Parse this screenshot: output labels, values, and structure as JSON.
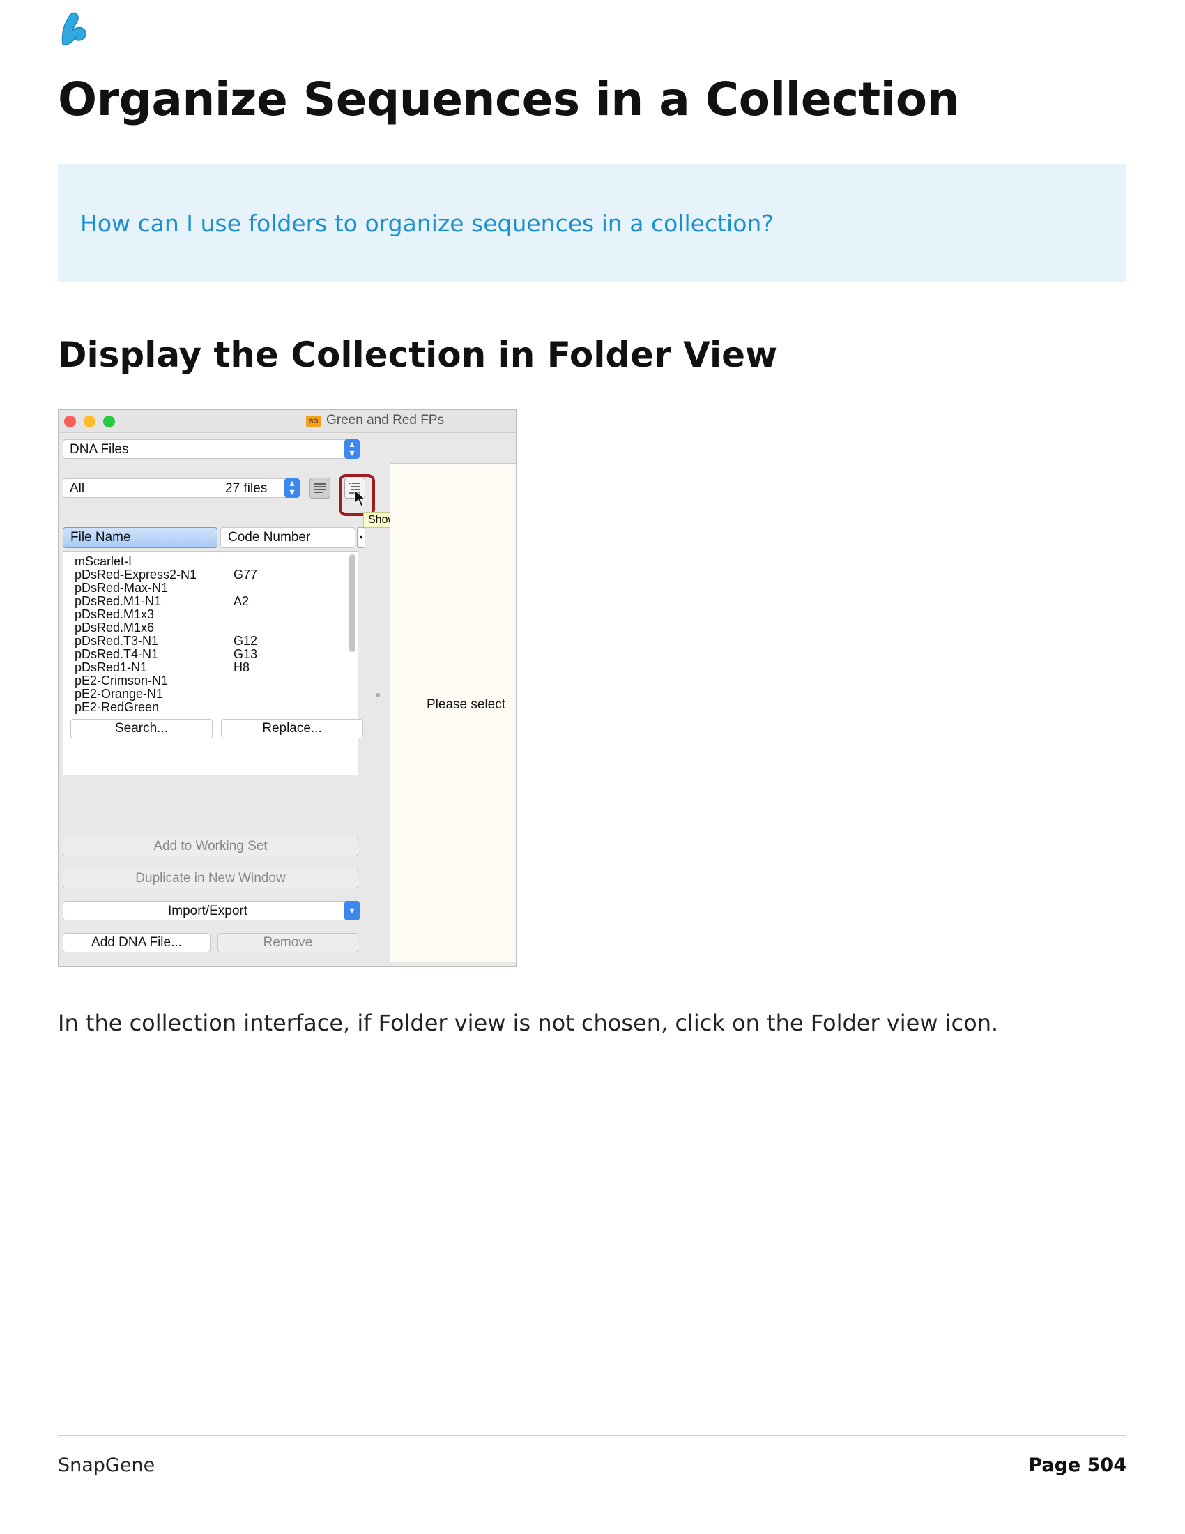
{
  "header": {
    "title": "Organize Sequences in a Collection",
    "question": "How can I use folders to organize sequences in a collection?"
  },
  "section": {
    "heading": "Display the Collection in Folder View",
    "paragraph": "In the collection interface, if Folder view is not chosen, click on the Folder view icon."
  },
  "screenshot": {
    "window_title": "Green and Red FPs",
    "badge": "SG",
    "file_type": "DNA Files",
    "filter": "All",
    "file_count": "27 files",
    "tooltip": "Show folder view",
    "columns": [
      "File Name",
      "Code Number"
    ],
    "rows": [
      {
        "name": "mScarlet-I",
        "code": ""
      },
      {
        "name": "pDsRed-Express2-N1",
        "code": "G77"
      },
      {
        "name": "pDsRed-Max-N1",
        "code": ""
      },
      {
        "name": "pDsRed.M1-N1",
        "code": "A2"
      },
      {
        "name": "pDsRed.M1x3",
        "code": ""
      },
      {
        "name": "pDsRed.M1x6",
        "code": ""
      },
      {
        "name": "pDsRed.T3-N1",
        "code": "G12"
      },
      {
        "name": "pDsRed.T4-N1",
        "code": "G13"
      },
      {
        "name": "pDsRed1-N1",
        "code": "H8"
      },
      {
        "name": "pE2-Crimson-N1",
        "code": ""
      },
      {
        "name": "pE2-Orange-N1",
        "code": ""
      },
      {
        "name": "pE2-RedGreen",
        "code": ""
      }
    ],
    "search_label": "Search...",
    "replace_label": "Replace...",
    "add_working_set": "Add to Working Set",
    "duplicate_window": "Duplicate in New Window",
    "import_export": "Import/Export",
    "add_file": "Add DNA File...",
    "remove": "Remove",
    "placeholder": "Please select"
  },
  "footer": {
    "brand": "SnapGene",
    "page": "Page 504"
  },
  "colors": {
    "callout_bg": "#e6f3fa",
    "callout_text": "#1b8fd0",
    "highlight": "#9c1c1f",
    "accent_blue": "#3d88f0"
  },
  "icons": [
    "snapgene-logo-icon",
    "list-view-icon",
    "folder-view-icon",
    "cursor-icon"
  ]
}
